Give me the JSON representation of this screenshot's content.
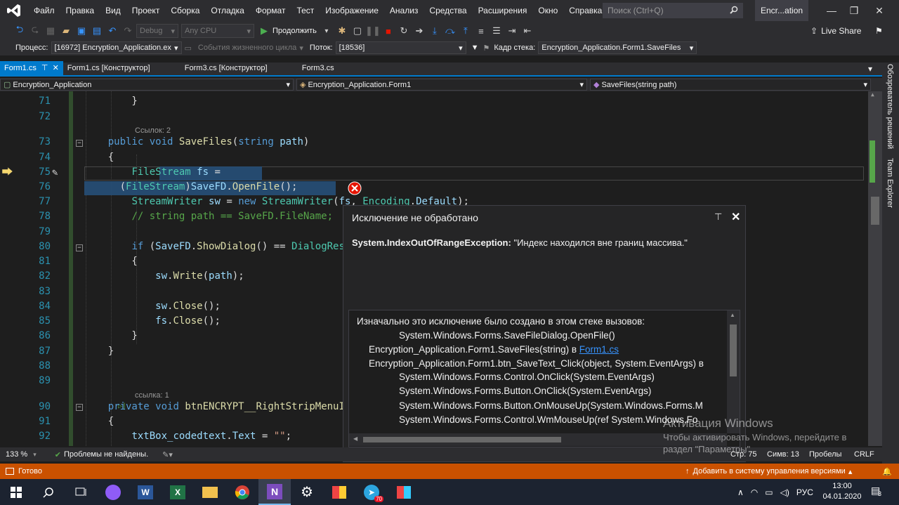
{
  "menu": {
    "items": [
      "Файл",
      "Правка",
      "Вид",
      "Проект",
      "Сборка",
      "Отладка",
      "Формат",
      "Тест",
      "Изображение",
      "Анализ",
      "Средства",
      "Расширения",
      "Окно",
      "Справка"
    ],
    "search_placeholder": "Поиск (Ctrl+Q)",
    "solution_name": "Encr...ation"
  },
  "toolbar": {
    "config": "Debug",
    "platform": "Any CPU",
    "continue_label": "Продолжить",
    "live_share": "Live Share"
  },
  "debugbar": {
    "process_label": "Процесс:",
    "process_value": "[16972] Encryption_Application.ex",
    "lifecycle": "События жизненного цикла",
    "thread_label": "Поток:",
    "thread_value": "[18536]",
    "stack_label": "Кадр стека:",
    "stack_value": "Encryption_Application.Form1.SaveFiles"
  },
  "tabs": [
    "Form1.cs",
    "Form1.cs [Конструктор]",
    "Form3.cs [Конструктор]",
    "Form3.cs"
  ],
  "nav": {
    "project": "Encryption_Application",
    "class": "Encryption_Application.Form1",
    "member": "SaveFiles(string path)"
  },
  "code": {
    "refs_73": "Ссылок: 2",
    "refs_90": "ссылка: 1",
    "lines": [
      "71",
      "72",
      "73",
      "74",
      "75",
      "76",
      "77",
      "78",
      "79",
      "80",
      "81",
      "82",
      "83",
      "84",
      "85",
      "86",
      "87",
      "88",
      "89",
      "90",
      "91",
      "92"
    ]
  },
  "exception": {
    "title": "Исключение не обработано",
    "type": "System.IndexOutOfRangeException:",
    "message": "\"Индекс находился вне границ массива.\"",
    "stack_header": "Изначально это исключение было создано в этом стеке вызовов:",
    "stack": [
      "System.Windows.Forms.SaveFileDialog.OpenFile()",
      "Encryption_Application.Form1.SaveFiles(string) в ",
      "Encryption_Application.Form1.btn_SaveText_Click(object, System.EventArgs) в",
      "System.Windows.Forms.Control.OnClick(System.EventArgs)",
      "System.Windows.Forms.Button.OnClick(System.EventArgs)",
      "System.Windows.Forms.Button.OnMouseUp(System.Windows.Forms.M",
      "System.Windows.Forms.Control.WmMouseUp(ref System.Windows.Fo"
    ],
    "stack_link": "Form1.cs"
  },
  "editor_status": {
    "zoom": "133 %",
    "problems": "Проблемы не найдены.",
    "line": "Стр: 75",
    "col": "Симв: 13",
    "spaces": "Пробелы",
    "eol": "CRLF"
  },
  "watermark": {
    "title": "Активация Windows",
    "line1": "Чтобы активировать Windows, перейдите в",
    "line2": "раздел \"Параметры\"."
  },
  "status": {
    "ready": "Готово",
    "vcs": "Добавить в систему управления версиями"
  },
  "side": {
    "solution_explorer": "Обозреватель решений",
    "team_explorer": "Team Explorer"
  },
  "taskbar": {
    "lang": "РУС",
    "time": "13:00",
    "date": "04.01.2020",
    "notif_count": "3",
    "telegram_badge": "70"
  },
  "colors": {
    "accent": "#007acc",
    "status_bar": "#ca5100",
    "error": "#e51400"
  }
}
